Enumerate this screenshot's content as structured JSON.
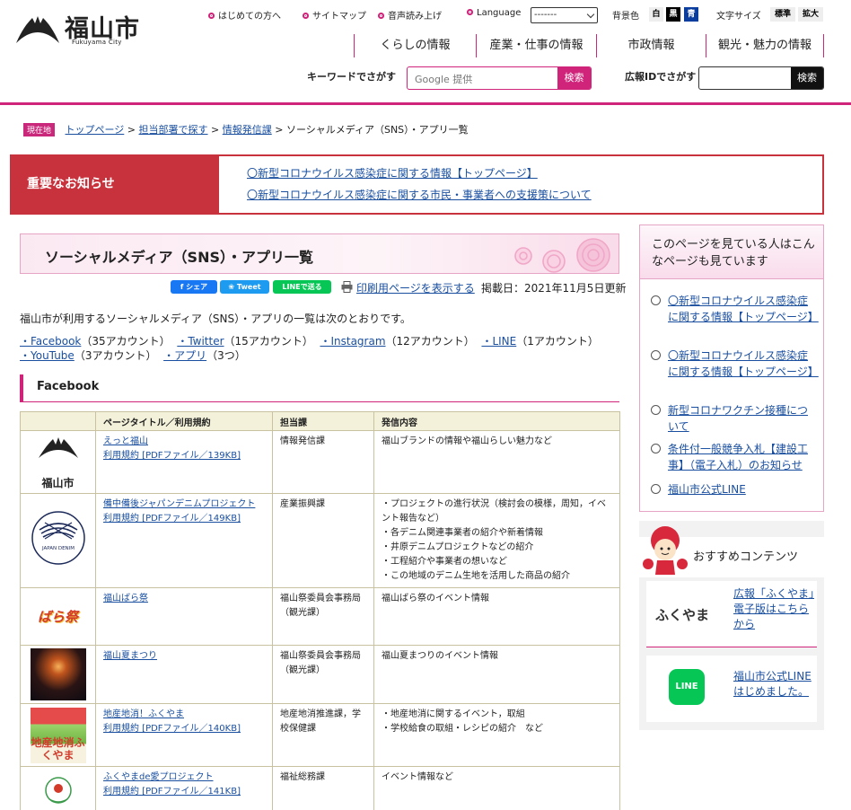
{
  "header": {
    "logo_text": "福山市",
    "logo_sub": "Fukuyama City",
    "util_links": [
      "はじめての方へ",
      "サイトマップ",
      "音声読み上げ",
      "Language"
    ],
    "language_value": "-------",
    "bg_label": "背景色",
    "bg_options": [
      "白",
      "黒",
      "青"
    ],
    "font_label": "文字サイズ",
    "font_options": [
      "標準",
      "拡大"
    ],
    "nav": [
      "くらしの情報",
      "産業・仕事の情報",
      "市政情報",
      "観光・魅力の情報"
    ],
    "keyword_label": "キーワードでさがす",
    "search_placeholder": "Google 提供",
    "search_button": "検索",
    "id_label": "広報IDでさがす",
    "id_button": "検索"
  },
  "breadcrumb": {
    "badge": "現在地",
    "items": [
      "トップページ",
      "担当部署で探す",
      "情報発信課",
      "ソーシャルメディア（SNS）・アプリ一覧"
    ]
  },
  "notice": {
    "title": "重要なお知らせ",
    "links": [
      "〇新型コロナウイルス感染症に関する情報【トップページ】",
      "〇新型コロナウイルス感染症に関する市民・事業者への支援策について"
    ]
  },
  "main": {
    "title": "ソーシャルメディア（SNS）・アプリ一覧",
    "share_buttons": [
      "シェア",
      "Tweet",
      "LINEで送る"
    ],
    "print_link": "印刷用ページを表示する",
    "posted": "掲載日：2021年11月5日更新",
    "intro": "福山市が利用するソーシャルメディア（SNS）・アプリの一覧は次のとおりです。",
    "index": [
      {
        "link": "・Facebook",
        "count": "（35アカウント）"
      },
      {
        "link": "・Twitter",
        "count": "（15アカウント）"
      },
      {
        "link": "・Instagram",
        "count": "（12アカウント）"
      },
      {
        "link": "・LINE",
        "count": "（1アカウント）"
      },
      {
        "link": "・YouTube",
        "count": "（3アカウント）"
      },
      {
        "link": "・アプリ",
        "count": "（3つ）"
      }
    ],
    "section_title": "Facebook",
    "table": {
      "headers": [
        "",
        "ページタイトル／利用規約",
        "担当課",
        "発信内容"
      ],
      "rows": [
        {
          "title": "えっと福山",
          "terms": "利用規約 [PDFファイル／139KB]",
          "dept": "情報発信課",
          "content": [
            "福山ブランドの情報や福山らしい魅力など"
          ],
          "img": "福山市"
        },
        {
          "title": "備中備後ジャパンデニムプロジェクト",
          "terms": "利用規約 [PDFファイル／149KB]",
          "dept": "産業振興課",
          "content": [
            "・プロジェクトの進行状況（検討会の模様，周知，イベント報告など）",
            "・各デニム関連事業者の紹介や新着情報",
            "・井原デニムプロジェクトなどの紹介",
            "・工程紹介や事業者の想いなど",
            "・この地域のデニム生地を活用した商品の紹介"
          ],
          "img": "JAPAN DENIM"
        },
        {
          "title": "福山ばら祭",
          "terms": "",
          "dept": "福山祭委員会事務局（観光課）",
          "content": [
            "福山ばら祭のイベント情報"
          ],
          "img": "ばら祭"
        },
        {
          "title": "福山夏まつり",
          "terms": "",
          "dept": "福山祭委員会事務局（観光課）",
          "content": [
            "福山夏まつりのイベント情報"
          ],
          "img": ""
        },
        {
          "title": "地産地消！ふくやま",
          "terms": "利用規約 [PDFファイル／140KB]",
          "dept": "地産地消推進課，学校保健課",
          "content": [
            "・地産地消に関するイベント，取組",
            "・学校給食の取組・レシピの紹介　など"
          ],
          "img": "地産地消ふくやま"
        },
        {
          "title": "ふくやまde愛プロジェクト",
          "terms": "利用規約 [PDFファイル／141KB]",
          "dept": "福祉総務課",
          "content": [
            "イベント情報など"
          ],
          "img": ""
        }
      ]
    }
  },
  "sidebar": {
    "related_title": "このページを見ている人はこんなページも見ています",
    "related": [
      "〇新型コロナウイルス感染症に関する情報【トップページ】",
      "〇新型コロナウイルス感染症に関する情報【トップページ】",
      "新型コロナワクチン接種について",
      "条件付一般競争入札【建設工事】（電子入札）のお知らせ",
      "福山市公式LINE"
    ],
    "recommend_title": "おすすめコンテンツ",
    "recommend": [
      {
        "logo": "ふくやま",
        "text": "広報「ふくやま」電子版はこちらから"
      },
      {
        "logo": "LINE",
        "text": "福山市公式LINEはじめました。"
      }
    ]
  },
  "colors": {
    "accent": "#d0237a",
    "notice": "#c8323d",
    "link": "#1a4fa0"
  }
}
